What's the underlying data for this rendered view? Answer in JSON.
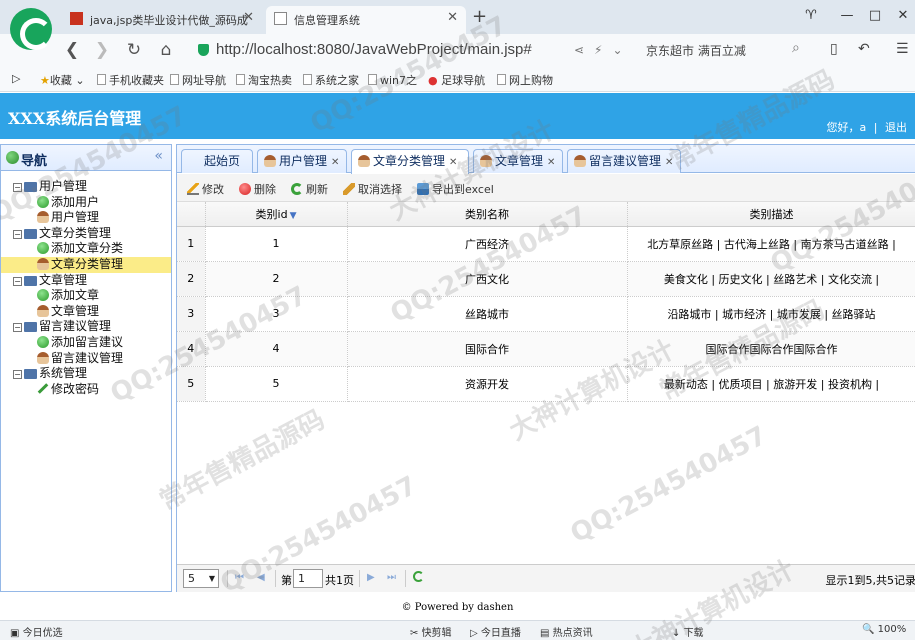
{
  "browser": {
    "tabs": [
      {
        "title": "java,jsp类毕业设计代做_源码成"
      },
      {
        "title": "信息管理系统"
      }
    ],
    "url": "http://localhost:8080/JavaWebProject/main.jsp#",
    "search_hint": "京东超市 满百立减",
    "bookmarks": [
      "收藏",
      "手机收藏夹",
      "网址导航",
      "淘宝热卖",
      "系统之家",
      "win7之",
      "足球导航",
      "网上购物"
    ]
  },
  "app": {
    "title": "XXX系统后台管理",
    "user_label": "您好，a",
    "logout_label": "退出"
  },
  "sidebar": {
    "title": "导航",
    "collapse_glyph": "«",
    "tree": [
      {
        "label": "用户管理",
        "children": [
          "添加用户",
          "用户管理"
        ]
      },
      {
        "label": "文章分类管理",
        "children": [
          "添加文章分类",
          "文章分类管理"
        ]
      },
      {
        "label": "文章管理",
        "children": [
          "添加文章",
          "文章管理"
        ]
      },
      {
        "label": "留言建议管理",
        "children": [
          "添加留言建议",
          "留言建议管理"
        ]
      },
      {
        "label": "系统管理",
        "children": [
          "修改密码"
        ]
      }
    ]
  },
  "tabs": [
    {
      "label": "起始页"
    },
    {
      "label": "用户管理"
    },
    {
      "label": "文章分类管理"
    },
    {
      "label": "文章管理"
    },
    {
      "label": "留言建议管理"
    }
  ],
  "toolbar": {
    "edit": "修改",
    "delete": "删除",
    "refresh": "刷新",
    "unselect": "取消选择",
    "export": "导出到excel"
  },
  "grid": {
    "columns": [
      "类别id",
      "类别名称",
      "类别描述"
    ],
    "rows": [
      {
        "num": "1",
        "id": "1",
        "name": "广西经济",
        "desc": "北方草原丝路 | 古代海上丝路 | 南方茶马古道丝路 |"
      },
      {
        "num": "2",
        "id": "2",
        "name": "广西文化",
        "desc": "美食文化 | 历史文化 | 丝路艺术 | 文化交流 |"
      },
      {
        "num": "3",
        "id": "3",
        "name": "丝路城市",
        "desc": "沿路城市 | 城市经济 | 城市发展 | 丝路驿站"
      },
      {
        "num": "4",
        "id": "4",
        "name": "国际合作",
        "desc": "国际合作国际合作国际合作"
      },
      {
        "num": "5",
        "id": "5",
        "name": "资源开发",
        "desc": "最新动态 | 优质项目 | 旅游开发 | 投资机构 |"
      }
    ]
  },
  "pager": {
    "page_size": "5",
    "page_prefix": "第",
    "page_value": "1",
    "page_total": "共1页",
    "info": "显示1到5,共5记录"
  },
  "footer": {
    "text": "© Powered by dashen"
  },
  "statusbar": {
    "left": "今日优选",
    "items": [
      "快剪辑",
      "今日直播",
      "热点资讯"
    ],
    "download": "下载",
    "zoom": "100%"
  },
  "watermark": {
    "qq": "QQ:254540457",
    "line1": "常年售精品源码",
    "line2": "大神计算机设计"
  }
}
